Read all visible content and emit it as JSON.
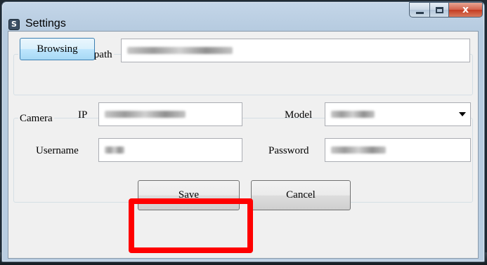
{
  "window": {
    "title": "Settings",
    "icon": "settings-app-icon",
    "caption_buttons": [
      "minimize",
      "maximize",
      "close"
    ],
    "close_glyph": "x"
  },
  "recording": {
    "group_label": "Recording folder path",
    "browse_label": "Browsing",
    "path_value": ""
  },
  "camera": {
    "group_label": "Camera",
    "ip_label": "IP",
    "ip_value": "",
    "model_label": "Model",
    "model_value": "",
    "username_label": "Username",
    "username_value": "",
    "password_label": "Password",
    "password_value": ""
  },
  "actions": {
    "save_label": "Save",
    "cancel_label": "Cancel"
  },
  "colors": {
    "highlight": "#ff0000",
    "titlebar": "#b9cde1",
    "client_bg": "#f0f0f0"
  }
}
